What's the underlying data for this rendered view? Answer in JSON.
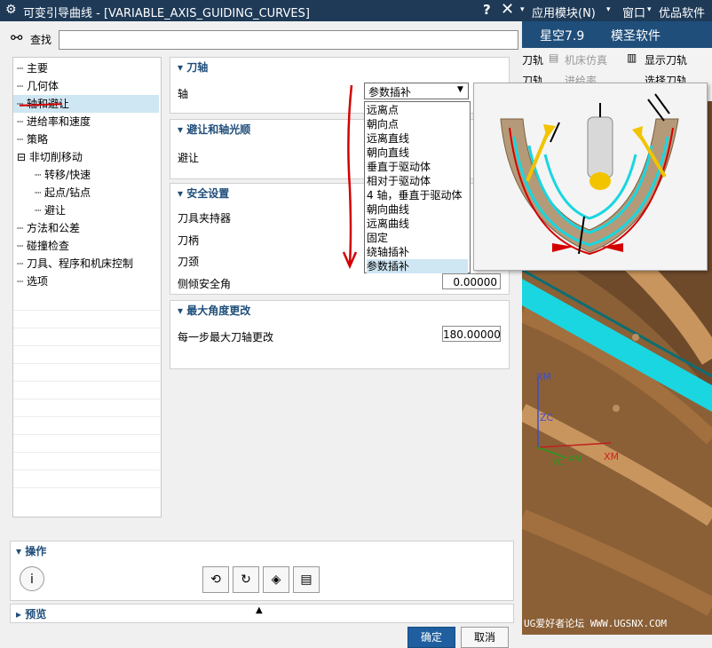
{
  "titlebar": {
    "title": "可变引导曲线 - [VARIABLE_AXIS_GUIDING_CURVES]",
    "help": "?",
    "close": "✕",
    "menus": [
      "应用模块(N)",
      "窗口",
      "优品软件"
    ]
  },
  "search": {
    "label": "查找",
    "value": ""
  },
  "app": {
    "banner": [
      "星空7.9",
      "模圣软件"
    ],
    "toolbar": [
      "刀轨",
      "机床仿真",
      "显示刀轨",
      "刀轨",
      "进给率",
      "选择刀轨"
    ],
    "axes": [
      "XM",
      "ZC",
      "YC",
      "XM",
      "XM"
    ],
    "watermark": "UG爱好者论坛 WWW.UGSNX.COM"
  },
  "nav": {
    "items": [
      {
        "label": "主要",
        "level": 0
      },
      {
        "label": "几何体",
        "level": 0
      },
      {
        "label": "轴和避让",
        "level": 0,
        "selected": true
      },
      {
        "label": "进给率和速度",
        "level": 0
      },
      {
        "label": "策略",
        "level": 0
      },
      {
        "label": "非切削移动",
        "level": 0,
        "expander": "⊟"
      },
      {
        "label": "转移/快速",
        "level": 1
      },
      {
        "label": "起点/钻点",
        "level": 1
      },
      {
        "label": "避让",
        "level": 1
      },
      {
        "label": "方法和公差",
        "level": 0
      },
      {
        "label": "碰撞检查",
        "level": 0
      },
      {
        "label": "刀具、程序和机床控制",
        "level": 0
      },
      {
        "label": "选项",
        "level": 0
      }
    ]
  },
  "groups": {
    "tool_axis": {
      "title": "刀轴",
      "axis_label": "轴",
      "axis_value": "参数插补"
    },
    "avoid": {
      "title": "避让和轴光顺",
      "avoid_label": "避让"
    },
    "safety": {
      "title": "安全设置",
      "holder": "刀具夹持器",
      "shank": "刀柄",
      "neck": "刀颈",
      "tilt_label": "侧倾安全角",
      "tilt_value": "0.00000"
    },
    "max_angle": {
      "title": "最大角度更改",
      "label": "每一步最大刀轴更改",
      "value": "180.00000"
    }
  },
  "axis_options": [
    "远离点",
    "朝向点",
    "远离直线",
    "朝向直线",
    "垂直于驱动体",
    "相对于驱动体",
    "4 轴，垂直于驱动体",
    "朝向曲线",
    "远离曲线",
    "固定",
    "绕轴插补",
    "参数插补"
  ],
  "axis_selected_index": 11,
  "operations": {
    "title": "操作",
    "info_icon": "info-icon",
    "buttons": [
      "generate-icon",
      "replay-icon",
      "verify-icon",
      "list-icon"
    ]
  },
  "preview": {
    "title": "预览"
  },
  "footer": {
    "ok": "确定",
    "cancel": "取消"
  },
  "colors": {
    "titlebar": "#1e3a57",
    "accent": "#1f4e7a",
    "annotation": "#d40000",
    "surface": "#6b4a2a",
    "cyan": "#19d6e0"
  }
}
